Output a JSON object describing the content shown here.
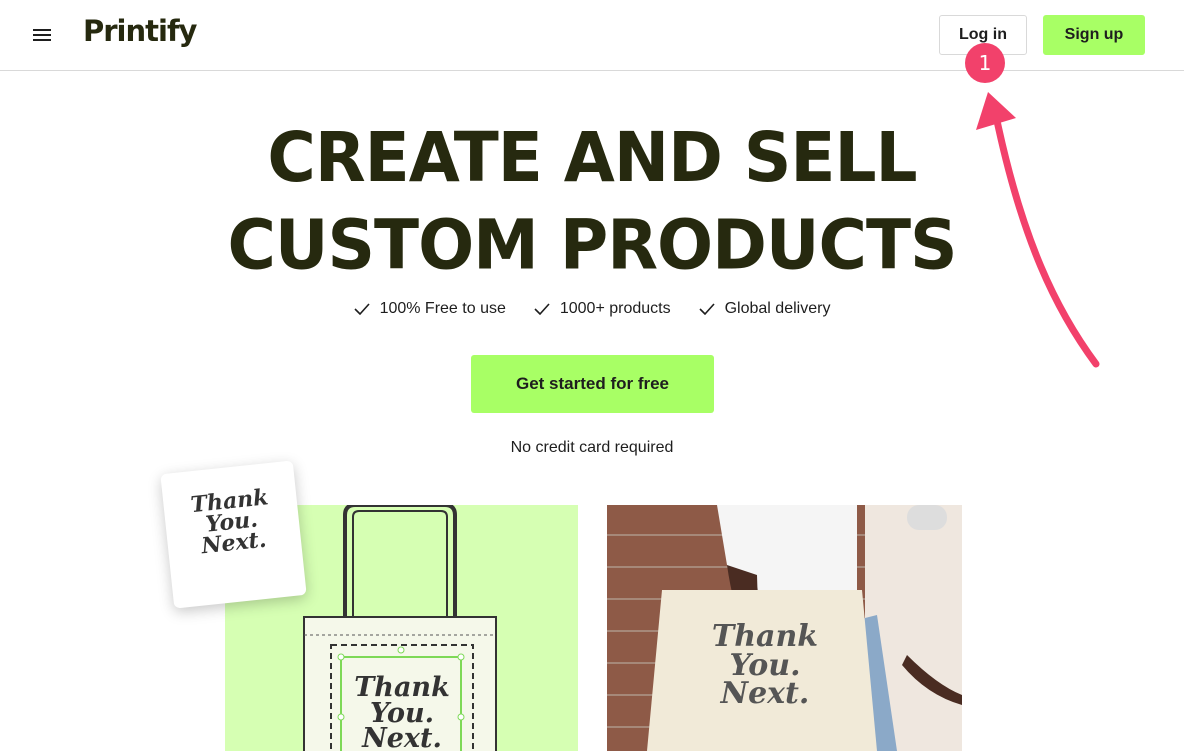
{
  "header": {
    "logo": "Printify",
    "login_label": "Log in",
    "signup_label": "Sign up"
  },
  "annotation": {
    "step": "1",
    "color": "#f2416b"
  },
  "hero": {
    "title_line1": "CREATE AND SELL",
    "title_line2": "CUSTOM PRODUCTS",
    "features": [
      "100% Free to use",
      "1000+ products",
      "Global delivery"
    ],
    "cta_label": "Get started for free",
    "note": "No credit card required"
  },
  "artwork": {
    "card_line1": "Thank",
    "card_line2": "You.",
    "card_line3": "Next."
  },
  "colors": {
    "accent": "#a8ff65",
    "dark": "#26290f",
    "panel": "#d6ffb3"
  }
}
